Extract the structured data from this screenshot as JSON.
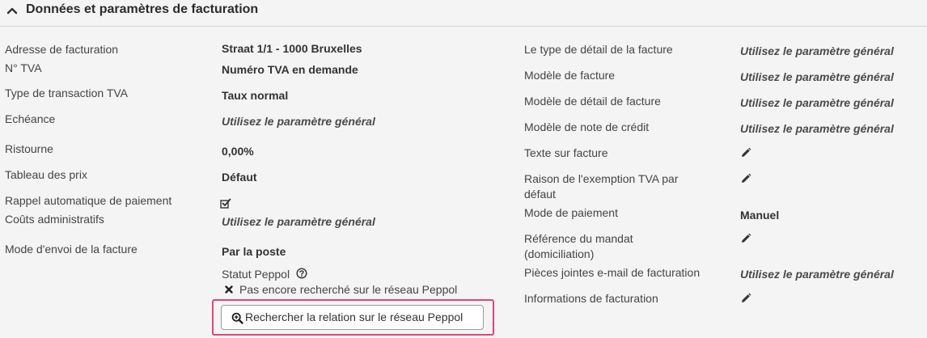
{
  "section": {
    "title": "Données et paramètres de facturation",
    "collapse_icon": "chevron-up-icon"
  },
  "left": {
    "billing_address": {
      "label": "Adresse de facturation",
      "value": "Straat 1/1 - 1000 Bruxelles"
    },
    "vat_number": {
      "label": "N° TVA",
      "value": "Numéro TVA en demande"
    },
    "vat_transaction_type": {
      "label": "Type de transaction TVA",
      "value": "Taux normal"
    },
    "due_date": {
      "label": "Echéance",
      "value": "Utilisez le paramètre général"
    },
    "discount": {
      "label": "Ristourne",
      "value": "0,00%"
    },
    "price_table": {
      "label": "Tableau des prix",
      "value": "Défaut"
    },
    "auto_reminder": {
      "label": "Rappel automatique de paiement",
      "checked": true,
      "icon": "checked-checkbox-icon"
    },
    "admin_costs": {
      "label": "Coûts administratifs",
      "value": "Utilisez le paramètre général"
    },
    "send_mode": {
      "label": "Mode d'envoi de la facture",
      "value": "Par la poste"
    }
  },
  "peppol": {
    "status_label": "Statut Peppol",
    "help_icon": "question-circle-icon",
    "status_icon": "x-mark-icon",
    "status_text": "Pas encore recherché sur le réseau Peppol",
    "search_button_label": "Rechercher la relation sur le réseau Peppol",
    "search_button_icon": "magnifier-plus-icon"
  },
  "right": {
    "invoice_detail_type": {
      "label": "Le type de détail de la facture",
      "value": "Utilisez le paramètre général"
    },
    "invoice_template": {
      "label": "Modèle de facture",
      "value": "Utilisez le paramètre général"
    },
    "invoice_detail_template": {
      "label": "Modèle de détail de facture",
      "value": "Utilisez le paramètre général"
    },
    "credit_note_template": {
      "label": "Modèle de note de crédit",
      "value": "Utilisez le paramètre général"
    },
    "invoice_text": {
      "label": "Texte sur facture",
      "icon": "pencil-icon"
    },
    "vat_exemption_reason": {
      "label_line1": "Raison de l'exemption TVA par",
      "label_line2": "défaut",
      "icon": "pencil-icon"
    },
    "payment_mode": {
      "label": "Mode de paiement",
      "value": "Manuel"
    },
    "mandate_reference": {
      "label_line1": "Référence du mandat",
      "label_line2": "(domiciliation)",
      "icon": "pencil-icon"
    },
    "email_attachments": {
      "label": "Pièces jointes e-mail de facturation",
      "value": "Utilisez le paramètre général"
    },
    "billing_info": {
      "label": "Informations de facturation",
      "icon": "pencil-icon"
    }
  }
}
